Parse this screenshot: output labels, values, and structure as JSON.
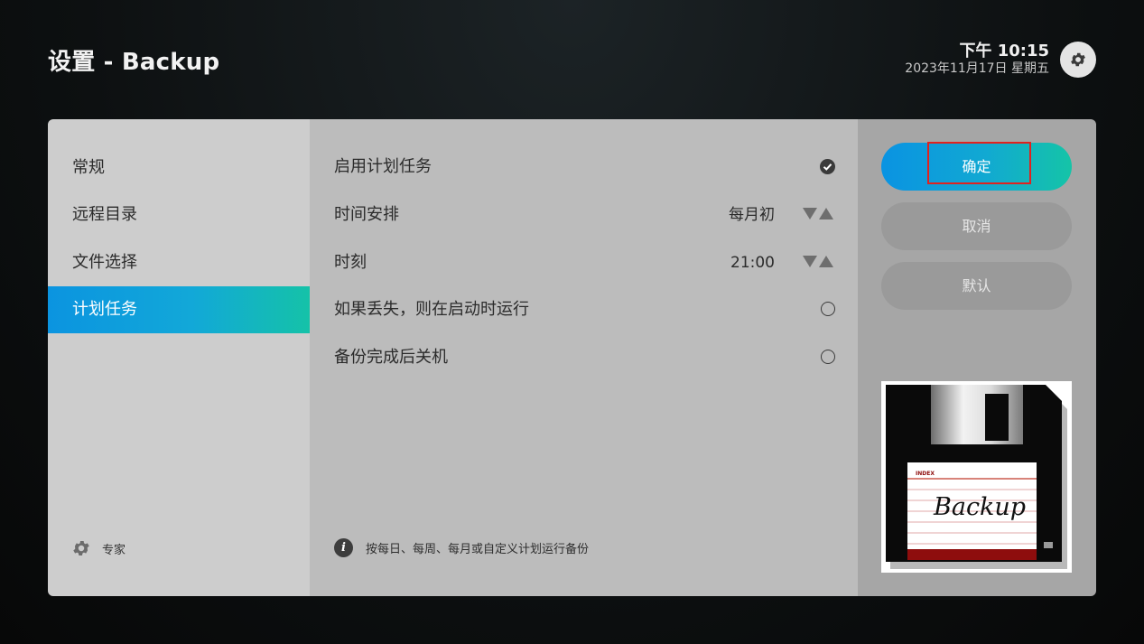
{
  "header": {
    "title": "设置 - Backup",
    "time": "下午 10:15",
    "date": "2023年11月17日 星期五",
    "settings_icon": "gear-icon"
  },
  "sidebar": {
    "items": [
      {
        "label": "常规",
        "active": false
      },
      {
        "label": "远程目录",
        "active": false
      },
      {
        "label": "文件选择",
        "active": false
      },
      {
        "label": "计划任务",
        "active": true
      }
    ],
    "expert_label": "专家",
    "expert_icon": "gear-icon"
  },
  "options": [
    {
      "label": "启用计划任务",
      "value": "",
      "control": "checkbox",
      "checked": true
    },
    {
      "label": "时间安排",
      "value": "每月初",
      "control": "spinner"
    },
    {
      "label": "时刻",
      "value": "21:00",
      "control": "spinner"
    },
    {
      "label": "如果丢失，则在启动时运行",
      "value": "",
      "control": "radio",
      "checked": false
    },
    {
      "label": "备份完成后关机",
      "value": "",
      "control": "radio",
      "checked": false
    }
  ],
  "hint": {
    "icon": "info-icon",
    "text": "按每日、每周、每月或自定义计划运行备份"
  },
  "actions": {
    "ok_label": "确定",
    "cancel_label": "取消",
    "default_label": "默认"
  },
  "thumbnail": {
    "index_label": "INDEX",
    "disk_label": "Backup"
  },
  "colors": {
    "accent_start": "#0a93e2",
    "accent_end": "#15c4a7",
    "highlight": "#e0221f"
  }
}
